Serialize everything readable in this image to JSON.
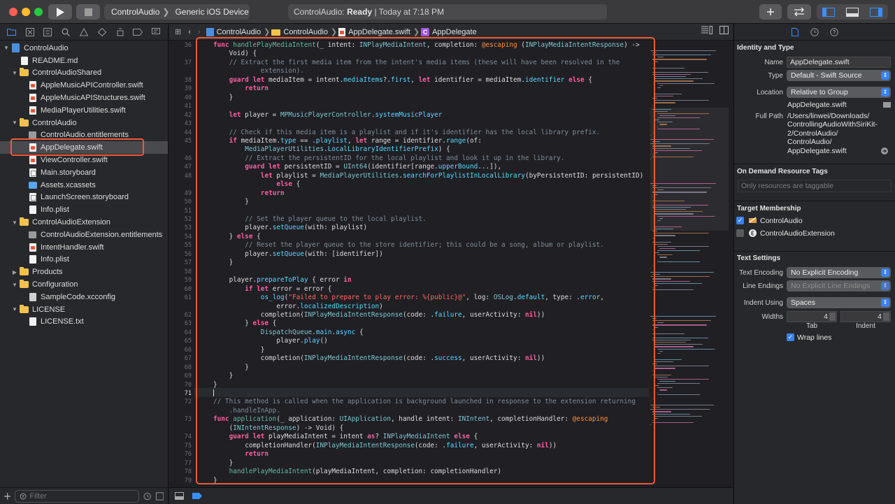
{
  "toolbar": {
    "scheme_target": "ControlAudio",
    "scheme_device": "Generic iOS Device",
    "activity_project": "ControlAudio:",
    "activity_status": "Ready",
    "activity_time": "| Today at 7:18 PM",
    "add_icon": "plus-icon",
    "review_icon": "swap-arrows-icon"
  },
  "navigator": {
    "filter_placeholder": "Filter",
    "items": [
      {
        "label": "ControlAudio",
        "level": 0,
        "icon": "project",
        "disclosure": "open"
      },
      {
        "label": "README.md",
        "level": 1,
        "icon": "file"
      },
      {
        "label": "ControlAudioShared",
        "level": 1,
        "icon": "folder",
        "disclosure": "open"
      },
      {
        "label": "AppleMusicAPIController.swift",
        "level": 2,
        "icon": "swift"
      },
      {
        "label": "AppleMusicAPIStructures.swift",
        "level": 2,
        "icon": "swift"
      },
      {
        "label": "MediaPlayerUtilities.swift",
        "level": 2,
        "icon": "swift"
      },
      {
        "label": "ControlAudio",
        "level": 1,
        "icon": "folder",
        "disclosure": "open"
      },
      {
        "label": "ControlAudio.entitlements",
        "level": 2,
        "icon": "ent"
      },
      {
        "label": "AppDelegate.swift",
        "level": 2,
        "icon": "swift",
        "selected": true
      },
      {
        "label": "ViewController.swift",
        "level": 2,
        "icon": "swift"
      },
      {
        "label": "Main.storyboard",
        "level": 2,
        "icon": "storyboard"
      },
      {
        "label": "Assets.xcassets",
        "level": 2,
        "icon": "assets"
      },
      {
        "label": "LaunchScreen.storyboard",
        "level": 2,
        "icon": "storyboard"
      },
      {
        "label": "Info.plist",
        "level": 2,
        "icon": "plist"
      },
      {
        "label": "ControlAudioExtension",
        "level": 1,
        "icon": "folder",
        "disclosure": "open"
      },
      {
        "label": "ControlAudioExtension.entitlements",
        "level": 2,
        "icon": "ent"
      },
      {
        "label": "IntentHandler.swift",
        "level": 2,
        "icon": "swift"
      },
      {
        "label": "Info.plist",
        "level": 2,
        "icon": "plist"
      },
      {
        "label": "Products",
        "level": 1,
        "icon": "folder",
        "disclosure": "closed"
      },
      {
        "label": "Configuration",
        "level": 1,
        "icon": "folder",
        "disclosure": "open"
      },
      {
        "label": "SampleCode.xcconfig",
        "level": 2,
        "icon": "config"
      },
      {
        "label": "LICENSE",
        "level": 1,
        "icon": "folder",
        "disclosure": "open"
      },
      {
        "label": "LICENSE.txt",
        "level": 2,
        "icon": "file"
      }
    ]
  },
  "jumpbar": {
    "crumbs": [
      "ControlAudio",
      "ControlAudio",
      "AppDelegate.swift",
      "AppDelegate"
    ]
  },
  "editor": {
    "current_line": "71",
    "lines": [
      {
        "n": "36",
        "indent": 0,
        "html": "<span class=\"kw\">func</span> <span class=\"fn\">handlePlayMediaIntent</span>(_ intent: <span class=\"ty\">INPlayMediaIntent</span>, completion: <span class=\"at\">@escaping</span> (<span class=\"ty\">INPlayMediaIntentResponse</span>) -&gt;"
      },
      {
        "n": "",
        "indent": 2,
        "html": "Void) {"
      },
      {
        "n": "37",
        "indent": 2,
        "html": "<span class=\"cm\">// Extract the first media item from the intent's media items (these will have been resolved in the</span>"
      },
      {
        "n": "",
        "indent": 6,
        "html": "<span class=\"cm\">extension).</span>"
      },
      {
        "n": "38",
        "indent": 2,
        "html": "<span class=\"kw\">guard let</span> mediaItem = intent.<span class=\"pv\">mediaItems</span>?.<span class=\"pv\">first</span>, <span class=\"kw\">let</span> identifier = mediaItem.<span class=\"pv\">identifier</span> <span class=\"kw\">else</span> {"
      },
      {
        "n": "39",
        "indent": 4,
        "html": "<span class=\"kw\">return</span>"
      },
      {
        "n": "40",
        "indent": 2,
        "html": "}"
      },
      {
        "n": "41",
        "indent": 0,
        "html": ""
      },
      {
        "n": "42",
        "indent": 2,
        "html": "<span class=\"kw\">let</span> player = <span class=\"ty\">MPMusicPlayerController</span>.<span class=\"pv\">systemMusicPlayer</span>"
      },
      {
        "n": "43",
        "indent": 0,
        "html": ""
      },
      {
        "n": "44",
        "indent": 2,
        "html": "<span class=\"cm\">// Check if this media item is a playlist and if it's identifier has the local library prefix.</span>"
      },
      {
        "n": "45",
        "indent": 2,
        "html": "<span class=\"kw\">if</span> mediaItem.<span class=\"pv\">type</span> == .<span class=\"pv\">playlist</span>, <span class=\"kw\">let</span> range = identifier.<span class=\"pv\">range</span>(of:"
      },
      {
        "n": "",
        "indent": 4,
        "html": "<span class=\"ty\">MediaPlayerUtilities</span>.<span class=\"pv\">LocalLibraryIdentifierPrefix</span>) {"
      },
      {
        "n": "46",
        "indent": 4,
        "html": "<span class=\"cm\">// Extract the persistentID for the local playlist and look it up in the library.</span>"
      },
      {
        "n": "47",
        "indent": 4,
        "html": "<span class=\"kw\">guard let</span> persistentID = <span class=\"ty\">UInt64</span>(identifier[range.<span class=\"pv\">upperBound</span>...]),"
      },
      {
        "n": "48",
        "indent": 6,
        "html": "<span class=\"kw\">let</span> playlist = <span class=\"ty\">MediaPlayerUtilities</span>.<span class=\"pv\">searchForPlaylistInLocalLibrary</span>(byPersistentID: persistentID)"
      },
      {
        "n": "",
        "indent": 8,
        "html": "<span class=\"kw\">else</span> {"
      },
      {
        "n": "49",
        "indent": 6,
        "html": "<span class=\"kw\">return</span>"
      },
      {
        "n": "50",
        "indent": 4,
        "html": "}"
      },
      {
        "n": "51",
        "indent": 0,
        "html": ""
      },
      {
        "n": "52",
        "indent": 4,
        "html": "<span class=\"cm\">// Set the player queue to the local playlist.</span>"
      },
      {
        "n": "53",
        "indent": 4,
        "html": "player.<span class=\"pv\">setQueue</span>(with: playlist)"
      },
      {
        "n": "54",
        "indent": 2,
        "html": "} <span class=\"kw\">else</span> {"
      },
      {
        "n": "55",
        "indent": 4,
        "html": "<span class=\"cm\">// Reset the player queue to the store identifier; this could be a song, album or playlist.</span>"
      },
      {
        "n": "56",
        "indent": 4,
        "html": "player.<span class=\"pv\">setQueue</span>(with: [identifier])"
      },
      {
        "n": "57",
        "indent": 2,
        "html": "}"
      },
      {
        "n": "58",
        "indent": 0,
        "html": ""
      },
      {
        "n": "59",
        "indent": 2,
        "html": "player.<span class=\"pv\">prepareToPlay</span> { error <span class=\"kw\">in</span>"
      },
      {
        "n": "60",
        "indent": 4,
        "html": "<span class=\"kw\">if let</span> error = error {"
      },
      {
        "n": "61",
        "indent": 6,
        "html": "<span class=\"pv\">os_log</span>(<span class=\"st\">\"Failed to prepare to play error: %{public}@\"</span>, log: <span class=\"ty\">OSLog</span>.<span class=\"pv\">default</span>, type: .<span class=\"pv\">error</span>,"
      },
      {
        "n": "",
        "indent": 8,
        "html": "error.<span class=\"pv\">localizedDescription</span>)"
      },
      {
        "n": "62",
        "indent": 6,
        "html": "completion(<span class=\"ty\">INPlayMediaIntentResponse</span>(code: .<span class=\"pv\">failure</span>, userActivity: <span class=\"kw\">nil</span>))"
      },
      {
        "n": "63",
        "indent": 4,
        "html": "} <span class=\"kw\">else</span> {"
      },
      {
        "n": "64",
        "indent": 6,
        "html": "<span class=\"ty\">DispatchQueue</span>.<span class=\"pv\">main</span>.<span class=\"pv\">async</span> {"
      },
      {
        "n": "65",
        "indent": 8,
        "html": "player.<span class=\"pv\">play</span>()"
      },
      {
        "n": "66",
        "indent": 6,
        "html": "}"
      },
      {
        "n": "67",
        "indent": 6,
        "html": "completion(<span class=\"ty\">INPlayMediaIntentResponse</span>(code: .<span class=\"pv\">success</span>, userActivity: <span class=\"kw\">nil</span>))"
      },
      {
        "n": "68",
        "indent": 4,
        "html": "}"
      },
      {
        "n": "69",
        "indent": 2,
        "html": "}"
      },
      {
        "n": "70",
        "indent": 0,
        "html": "}"
      },
      {
        "n": "71",
        "indent": 0,
        "html": ""
      },
      {
        "n": "72",
        "indent": 0,
        "html": "<span class=\"cm\">// This method is called when the application is background launched in response to the extension returning</span>"
      },
      {
        "n": "",
        "indent": 2,
        "html": "<span class=\"cm\">.handleInApp.</span>"
      },
      {
        "n": "73",
        "indent": 0,
        "html": "<span class=\"kw\">func</span> <span class=\"fn\">application</span>(_ application: <span class=\"ty\">UIApplication</span>, handle intent: <span class=\"ty\">INIntent</span>, completionHandler: <span class=\"at\">@escaping</span>"
      },
      {
        "n": "",
        "indent": 2,
        "html": "(<span class=\"ty\">INIntentResponse</span>) -&gt; Void) {"
      },
      {
        "n": "74",
        "indent": 2,
        "html": "<span class=\"kw\">guard let</span> playMediaIntent = intent <span class=\"kw\">as</span>? <span class=\"ty\">INPlayMediaIntent</span> <span class=\"kw\">else</span> {"
      },
      {
        "n": "75",
        "indent": 4,
        "html": "completionHandler(<span class=\"ty\">INPlayMediaIntentResponse</span>(code: .<span class=\"pv\">failure</span>, userActivity: <span class=\"kw\">nil</span>))"
      },
      {
        "n": "76",
        "indent": 4,
        "html": "<span class=\"kw\">return</span>"
      },
      {
        "n": "77",
        "indent": 2,
        "html": "}"
      },
      {
        "n": "78",
        "indent": 2,
        "html": "<span class=\"fn\">handlePlayMediaIntent</span>(playMediaIntent, completion: completionHandler)"
      },
      {
        "n": "79",
        "indent": 0,
        "html": "}"
      }
    ]
  },
  "inspector": {
    "identity_title": "Identity and Type",
    "name_label": "Name",
    "name_value": "AppDelegate.swift",
    "type_label": "Type",
    "type_value": "Default - Swift Source",
    "location_label": "Location",
    "location_value": "Relative to Group",
    "location_file": "AppDelegate.swift",
    "fullpath_label": "Full Path",
    "fullpath_lines": [
      "/Users/linwei/Downloads/",
      "ControllingAudioWithSiriKit-",
      "2/ControlAudio/",
      "ControlAudio/",
      "AppDelegate.swift"
    ],
    "odr_title": "On Demand Resource Tags",
    "odr_placeholder": "Only resources are taggable",
    "target_title": "Target Membership",
    "targets": [
      {
        "label": "ControlAudio",
        "checked": true
      },
      {
        "label": "ControlAudioExtension",
        "checked": false
      }
    ],
    "text_title": "Text Settings",
    "encoding_label": "Text Encoding",
    "encoding_value": "No Explicit Encoding",
    "endings_label": "Line Endings",
    "endings_value": "No Explicit Line Endings",
    "indent_label": "Indent Using",
    "indent_value": "Spaces",
    "widths_label": "Widths",
    "tab_width": "4",
    "indent_width": "4",
    "tab_caption": "Tab",
    "indent_caption": "Indent",
    "wrap_label": "Wrap lines",
    "wrap_checked": true
  }
}
